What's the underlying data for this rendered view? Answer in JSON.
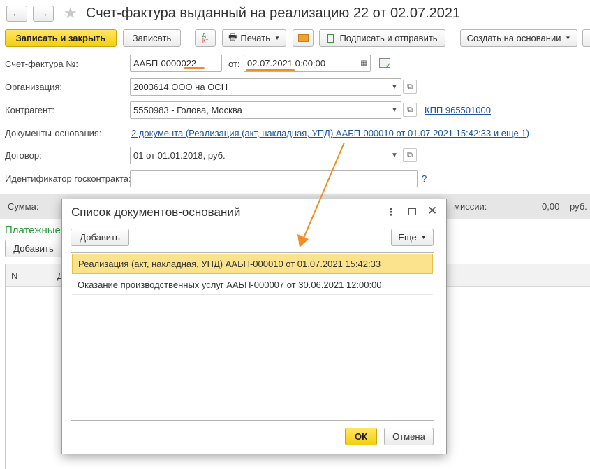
{
  "window": {
    "title": "Счет-фактура выданный на реализацию 22 от 02.07.2021"
  },
  "toolbar": {
    "save_close": "Записать и закрыть",
    "save": "Записать",
    "dt_kt": "Дт Кт",
    "print": "Печать",
    "sign_send": "Подписать и отправить",
    "create_based": "Создать на основании"
  },
  "form": {
    "invoice_label": "Счет-фактура №:",
    "invoice_number": "ААБП-0000022",
    "date_label": "от:",
    "date_value": "02.07.2021  0:00:00",
    "org_label": "Организация:",
    "org_value": "2003614 ООО на ОСН",
    "counterparty_label": "Контрагент:",
    "counterparty_value": "5550983 - Голова, Москва",
    "kpp_link": "КПП 965501000",
    "base_docs_label": "Документы-основания:",
    "base_docs_link": "2 документа (Реализация (акт, накладная, УПД) ААБП-000010 от 01.07.2021 15:42:33 и еще 1)",
    "contract_label": "Договор:",
    "contract_value": "01 от 01.01.2018, руб.",
    "gov_id_label": "Идентификатор госконтракта:",
    "gov_id_value": "",
    "help": "?"
  },
  "summary": {
    "sum_label": "Сумма:",
    "commission_label": "миссии:",
    "commission_value": "0,00",
    "currency": "руб."
  },
  "payments": {
    "title": "Платежные",
    "add_button": "Добавить",
    "col_n": "N",
    "col_d": "Д"
  },
  "dialog": {
    "title": "Список документов-оснований",
    "add_button": "Добавить",
    "more_button": "Еще",
    "rows": [
      "Реализация (акт, накладная, УПД) ААБП-000010 от 01.07.2021 15:42:33",
      "Оказание производственных услуг ААБП-000007 от 30.06.2021 12:00:00"
    ],
    "ok_button": "ОК",
    "cancel_button": "Отмена"
  },
  "colors": {
    "accent_yellow": "#f4cf0e",
    "link_blue": "#1a55a0",
    "payments_green": "#2b9b3c",
    "annotation_orange": "#f28c28",
    "selected_row": "#fbe38e"
  }
}
